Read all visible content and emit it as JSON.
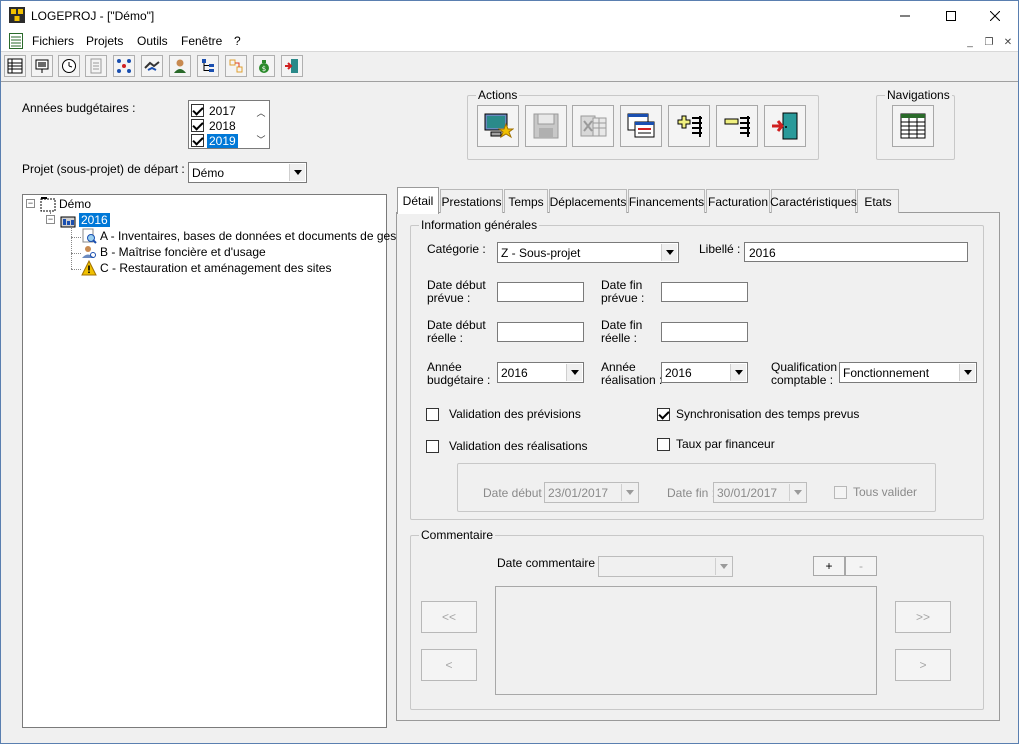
{
  "window": {
    "title": "LOGEPROJ - [\"Démo\"]",
    "app_icon": "logeproj-app-icon",
    "controls": [
      "minimize-icon",
      "maximize-icon",
      "close-icon"
    ]
  },
  "menubar": {
    "items": [
      "Fichiers",
      "Projets",
      "Outils",
      "Fenêtre",
      "?"
    ],
    "mdi_controls": [
      "minimize-icon",
      "restore-icon",
      "close-icon"
    ]
  },
  "toolbar": {
    "buttons": [
      "grid-icon",
      "projector-icon",
      "clock-icon",
      "document-icon",
      "network-icon",
      "handshake-icon",
      "user-icon",
      "tree-icon",
      "transfer-icon",
      "money-bag-icon",
      "exit-door-icon"
    ]
  },
  "left": {
    "budget_years_label": "Années budgétaires :",
    "budget_years": [
      {
        "label": "2017",
        "checked": true,
        "selected": false
      },
      {
        "label": "2018",
        "checked": true,
        "selected": false
      },
      {
        "label": "2019",
        "checked": true,
        "selected": true
      }
    ],
    "start_project_label": "Projet (sous-projet) de départ :",
    "start_project_value": "Démo"
  },
  "tree": {
    "root": "Démo",
    "child": "2016",
    "leaves": [
      {
        "label": "A - Inventaires, bases de données et documents de gestion",
        "icon": "search-document-icon"
      },
      {
        "label": "B - Maîtrise foncière et d'usage",
        "icon": "user-search-icon"
      },
      {
        "label": "C - Restauration et aménagement des sites",
        "icon": "warning-icon"
      }
    ]
  },
  "actions": {
    "title": "Actions",
    "buttons": [
      "computer-star-icon",
      "save-disk-icon",
      "excel-grid-icon",
      "window-list-icon",
      "add-line-icon",
      "remove-line-icon",
      "exit-door-icon"
    ]
  },
  "navigations": {
    "title": "Navigations",
    "button": "spreadsheet-icon"
  },
  "tabs": [
    "Détail",
    "Prestations",
    "Temps",
    "Déplacements",
    "Financements",
    "Facturation",
    "Caractéristiques",
    "Etats"
  ],
  "general": {
    "title": "Information générales",
    "category_label": "Catégorie :",
    "category_value": "Z - Sous-projet",
    "libelle_label": "Libellé :",
    "libelle_value": "2016",
    "date_debut_prevue_label": [
      "Date début",
      "prévue :"
    ],
    "date_fin_prevue_label": [
      "Date fin",
      "prévue :"
    ],
    "date_debut_reelle_label": [
      "Date début",
      "réelle :"
    ],
    "date_fin_reelle_label": [
      "Date fin",
      "réelle :"
    ],
    "annee_budgetaire_label": [
      "Année",
      "budgétaire :"
    ],
    "annee_budgetaire_value": "2016",
    "annee_realisation_label": [
      "Année",
      "réalisation :"
    ],
    "annee_realisation_value": "2016",
    "qualification_label": [
      "Qualification",
      "comptable :"
    ],
    "qualification_value": "Fonctionnement",
    "validation_previsions": {
      "label": "Validation des prévisions",
      "checked": false
    },
    "validation_realisations": {
      "label": "Validation des réalisations",
      "checked": false
    },
    "synchronisation": {
      "label": "Synchronisation des temps prevus",
      "checked": true
    },
    "taux_financeur": {
      "label": "Taux par financeur",
      "checked": false
    },
    "date_debut_label": "Date début :",
    "date_debut_value": "23/01/2017",
    "date_fin_label": "Date fin :",
    "date_fin_value": "30/01/2017",
    "tous_valider_label": "Tous valider"
  },
  "comment": {
    "title": "Commentaire",
    "date_label": "Date commentaire :",
    "date_value": "",
    "add_label": "+",
    "remove_label": "-",
    "first_label": "<<",
    "prev_label": "<",
    "last_label": ">>",
    "next_label": ">"
  }
}
